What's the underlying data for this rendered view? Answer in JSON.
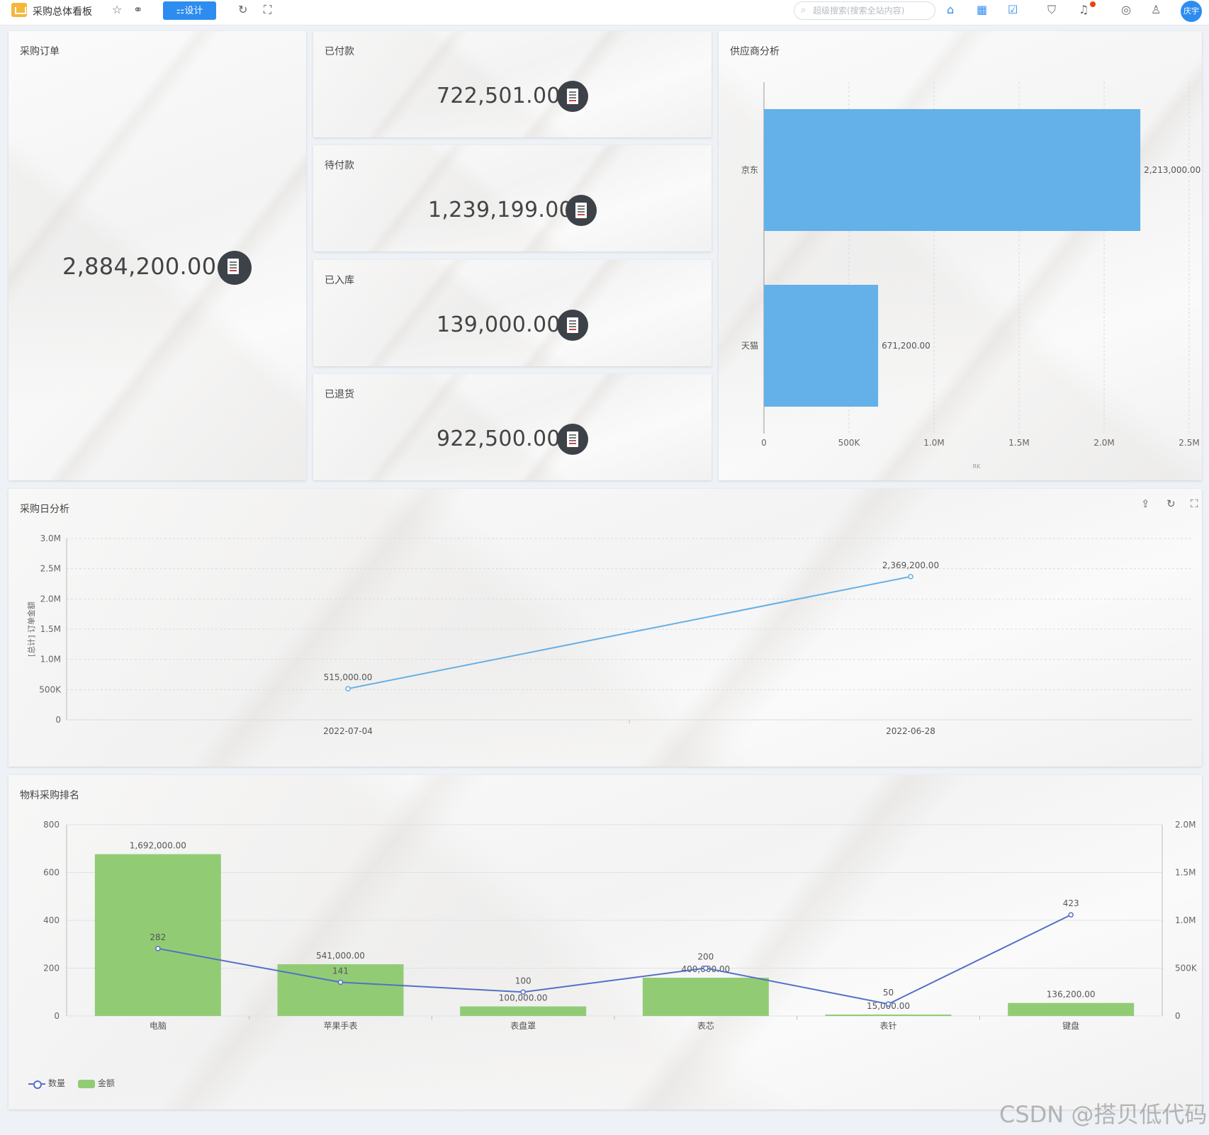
{
  "toolbar": {
    "app_title": "采购总体看板",
    "design_label": "⚏设计",
    "search_placeholder": "超级搜索(搜索全站内容)",
    "avatar_text": "庆宇"
  },
  "cards": {
    "orders": {
      "title": "采购订单",
      "value": "2,884,200.00"
    },
    "paid": {
      "title": "已付款",
      "value": "722,501.00"
    },
    "pending": {
      "title": "待付款",
      "value": "1,239,199.00"
    },
    "stocked": {
      "title": "已入库",
      "value": "139,000.00"
    },
    "returned": {
      "title": "已退货",
      "value": "922,500.00"
    }
  },
  "supplier_panel": {
    "title": "供应商分析",
    "axis_unit": "RK"
  },
  "daily_panel": {
    "title": "采购日分析",
    "ylabel": "[总计] 订单金额"
  },
  "ranking_panel": {
    "title": "物料采购排名"
  },
  "legend": {
    "qty": "数量",
    "amount": "金额"
  },
  "watermark": "CSDN @搭贝低代码",
  "colors": {
    "blue_bar": "#64b0e8",
    "line": "#64b0e8",
    "green_bar": "#91cc75",
    "line2": "#5470c6",
    "primary": "#2d8cf0"
  },
  "chart_data": [
    {
      "type": "bar",
      "orientation": "horizontal",
      "categories": [
        "京东",
        "天猫"
      ],
      "values": [
        2213000,
        671200
      ],
      "labels": [
        "2,213,000.00",
        "671,200.00"
      ],
      "xlim": [
        0,
        2500000
      ],
      "xticks": [
        "0",
        "500K",
        "1.0M",
        "1.5M",
        "2.0M",
        "2.5M"
      ],
      "xlabel": "RK"
    },
    {
      "type": "line",
      "x": [
        "2022-07-04",
        "2022-06-28"
      ],
      "values": [
        515000,
        2369200
      ],
      "labels": [
        "515,000.00",
        "2,369,200.00"
      ],
      "ylim": [
        0,
        3000000
      ],
      "yticks": [
        "0",
        "500K",
        "1.0M",
        "1.5M",
        "2.0M",
        "2.5M",
        "3.0M"
      ],
      "ylabel": "[总计] 订单金额"
    },
    {
      "type": "bar",
      "categories": [
        "电脑",
        "苹果手表",
        "表盘罩",
        "表芯",
        "表针",
        "键盘"
      ],
      "series": [
        {
          "name": "金额",
          "type": "bar",
          "axis": "right",
          "values": [
            1692000,
            541000,
            100000,
            400000,
            15000,
            136200
          ],
          "labels": [
            "1,692,000.00",
            "541,000.00",
            "100,000.00",
            "400,000.00",
            "15,000.00",
            "136,200.00"
          ]
        },
        {
          "name": "数量",
          "type": "line",
          "axis": "left",
          "values": [
            282,
            141,
            100,
            200,
            50,
            423
          ],
          "labels": [
            "282",
            "141",
            "100",
            "200",
            "50",
            "423"
          ]
        }
      ],
      "ylim_left": [
        0,
        800
      ],
      "yticks_left": [
        "0",
        "200",
        "400",
        "600",
        "800"
      ],
      "ylim_right": [
        0,
        2000000
      ],
      "yticks_right": [
        "0",
        "500K",
        "1.0M",
        "1.5M",
        "2.0M"
      ]
    }
  ]
}
